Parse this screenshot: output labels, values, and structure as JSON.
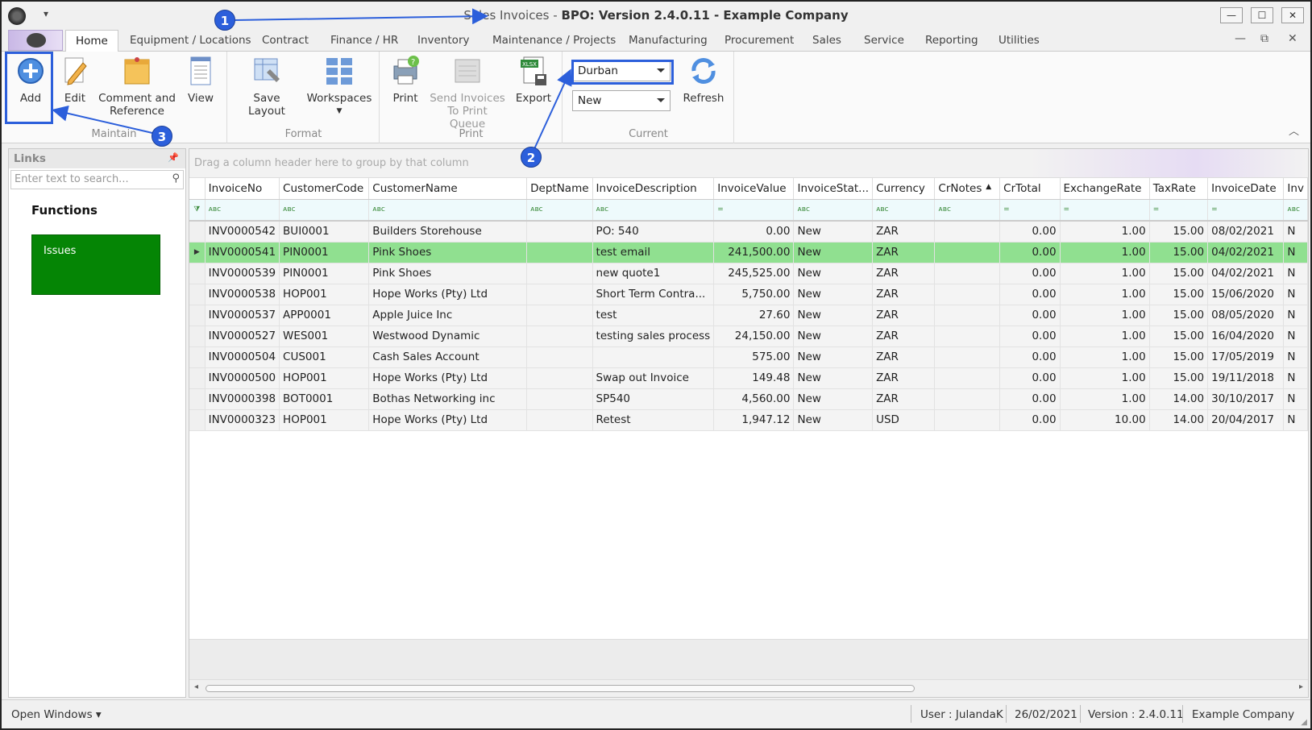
{
  "titlebar": {
    "qat": "▾",
    "app": "Sales Invoices",
    "dash": " - ",
    "product": "BPO: Version 2.4.0.11 - Example Company",
    "min": "—",
    "max": "☐",
    "close": "✕"
  },
  "tabs": [
    "Home",
    "Equipment / Locations",
    "Contract",
    "Finance / HR",
    "Inventory",
    "Maintenance / Projects",
    "Manufacturing",
    "Procurement",
    "Sales",
    "Service",
    "Reporting",
    "Utilities"
  ],
  "mdi": {
    "min": "—",
    "restore": "⧉",
    "close": "✕"
  },
  "ribbon": {
    "maintain": {
      "label": "Maintain",
      "add": "Add",
      "edit": "Edit",
      "comment": "Comment and Reference",
      "view": "View"
    },
    "format": {
      "label": "Format",
      "save_layout": "Save Layout",
      "workspaces": "Workspaces"
    },
    "print": {
      "label": "Print",
      "print": "Print",
      "send": "Send Invoices To Print Queue",
      "export": "Export"
    },
    "current": {
      "label": "Current",
      "site": "Durban",
      "status": "New",
      "refresh": "Refresh"
    }
  },
  "links": {
    "title": "Links",
    "search_placeholder": "Enter text to search...",
    "functions": "Functions",
    "tile": "Issues"
  },
  "grid": {
    "group_hint": "Drag a column header here to group by that column",
    "columns": [
      "InvoiceNo",
      "CustomerCode",
      "CustomerName",
      "DeptName",
      "InvoiceDescription",
      "InvoiceValue",
      "InvoiceStat...",
      "Currency",
      "CrNotes",
      "CrTotal",
      "ExchangeRate",
      "TaxRate",
      "InvoiceDate",
      "Inv"
    ],
    "rows": [
      [
        "INV0000542",
        "BUI0001",
        "Builders Storehouse",
        "",
        "PO: 540",
        "0.00",
        "New",
        "ZAR",
        "",
        "0.00",
        "1.00",
        "15.00",
        "08/02/2021",
        "N"
      ],
      [
        "INV0000541",
        "PIN0001",
        "Pink Shoes",
        "",
        "test email",
        "241,500.00",
        "New",
        "ZAR",
        "",
        "0.00",
        "1.00",
        "15.00",
        "04/02/2021",
        "N"
      ],
      [
        "INV0000539",
        "PIN0001",
        "Pink Shoes",
        "",
        "new quote1",
        "245,525.00",
        "New",
        "ZAR",
        "",
        "0.00",
        "1.00",
        "15.00",
        "04/02/2021",
        "N"
      ],
      [
        "INV0000538",
        "HOP001",
        "Hope Works (Pty) Ltd",
        "",
        "Short Term Contra...",
        "5,750.00",
        "New",
        "ZAR",
        "",
        "0.00",
        "1.00",
        "15.00",
        "15/06/2020",
        "N"
      ],
      [
        "INV0000537",
        "APP0001",
        "Apple Juice Inc",
        "",
        "test",
        "27.60",
        "New",
        "ZAR",
        "",
        "0.00",
        "1.00",
        "15.00",
        "08/05/2020",
        "N"
      ],
      [
        "INV0000527",
        "WES001",
        "Westwood Dynamic",
        "",
        "testing sales process",
        "24,150.00",
        "New",
        "ZAR",
        "",
        "0.00",
        "1.00",
        "15.00",
        "16/04/2020",
        "N"
      ],
      [
        "INV0000504",
        "CUS001",
        "Cash Sales Account",
        "",
        "",
        "575.00",
        "New",
        "ZAR",
        "",
        "0.00",
        "1.00",
        "15.00",
        "17/05/2019",
        "N"
      ],
      [
        "INV0000500",
        "HOP001",
        "Hope Works (Pty) Ltd",
        "",
        "Swap out Invoice",
        "149.48",
        "New",
        "ZAR",
        "",
        "0.00",
        "1.00",
        "15.00",
        "19/11/2018",
        "N"
      ],
      [
        "INV0000398",
        "BOT0001",
        "Bothas Networking inc",
        "",
        "SP540",
        "4,560.00",
        "New",
        "ZAR",
        "",
        "0.00",
        "1.00",
        "14.00",
        "30/10/2017",
        "N"
      ],
      [
        "INV0000323",
        "HOP001",
        "Hope Works (Pty) Ltd",
        "",
        "Retest",
        "1,947.12",
        "New",
        "USD",
        "",
        "0.00",
        "10.00",
        "14.00",
        "20/04/2017",
        "N"
      ]
    ],
    "selected_row": 1
  },
  "status": {
    "open_windows": "Open Windows ▾",
    "user": "User : JulandaK",
    "date": "26/02/2021",
    "version": "Version : 2.4.0.11",
    "company": "Example Company"
  },
  "annotations": [
    "1",
    "2",
    "3"
  ],
  "colors": {
    "accent": "#2c5fdb",
    "selected_row": "#90e090",
    "tile": "#058505"
  }
}
